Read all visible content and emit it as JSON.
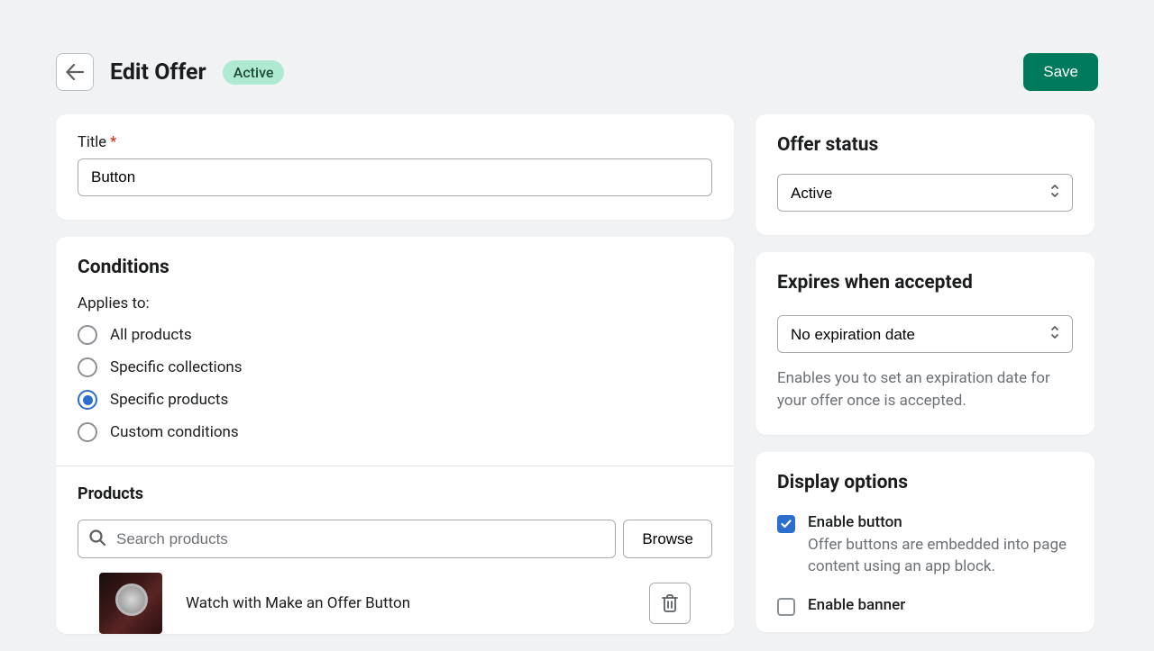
{
  "header": {
    "title": "Edit Offer",
    "badge": "Active",
    "save_label": "Save"
  },
  "title_field": {
    "label": "Title",
    "value": "Button"
  },
  "conditions": {
    "heading": "Conditions",
    "applies_to_label": "Applies to:",
    "options": {
      "all": "All products",
      "collections": "Specific collections",
      "products": "Specific products",
      "custom": "Custom conditions"
    }
  },
  "products": {
    "heading": "Products",
    "search_placeholder": "Search products",
    "browse_label": "Browse",
    "item_name": "Watch with Make an Offer Button"
  },
  "offer_status": {
    "heading": "Offer status",
    "selected": "Active"
  },
  "expiration": {
    "heading": "Expires when accepted",
    "selected": "No expiration date",
    "help": "Enables you to set an expiration date for your offer once is accepted."
  },
  "display": {
    "heading": "Display options",
    "enable_button_label": "Enable button",
    "enable_button_desc": "Offer buttons are embedded into page content using an app block.",
    "enable_banner_label": "Enable banner"
  }
}
